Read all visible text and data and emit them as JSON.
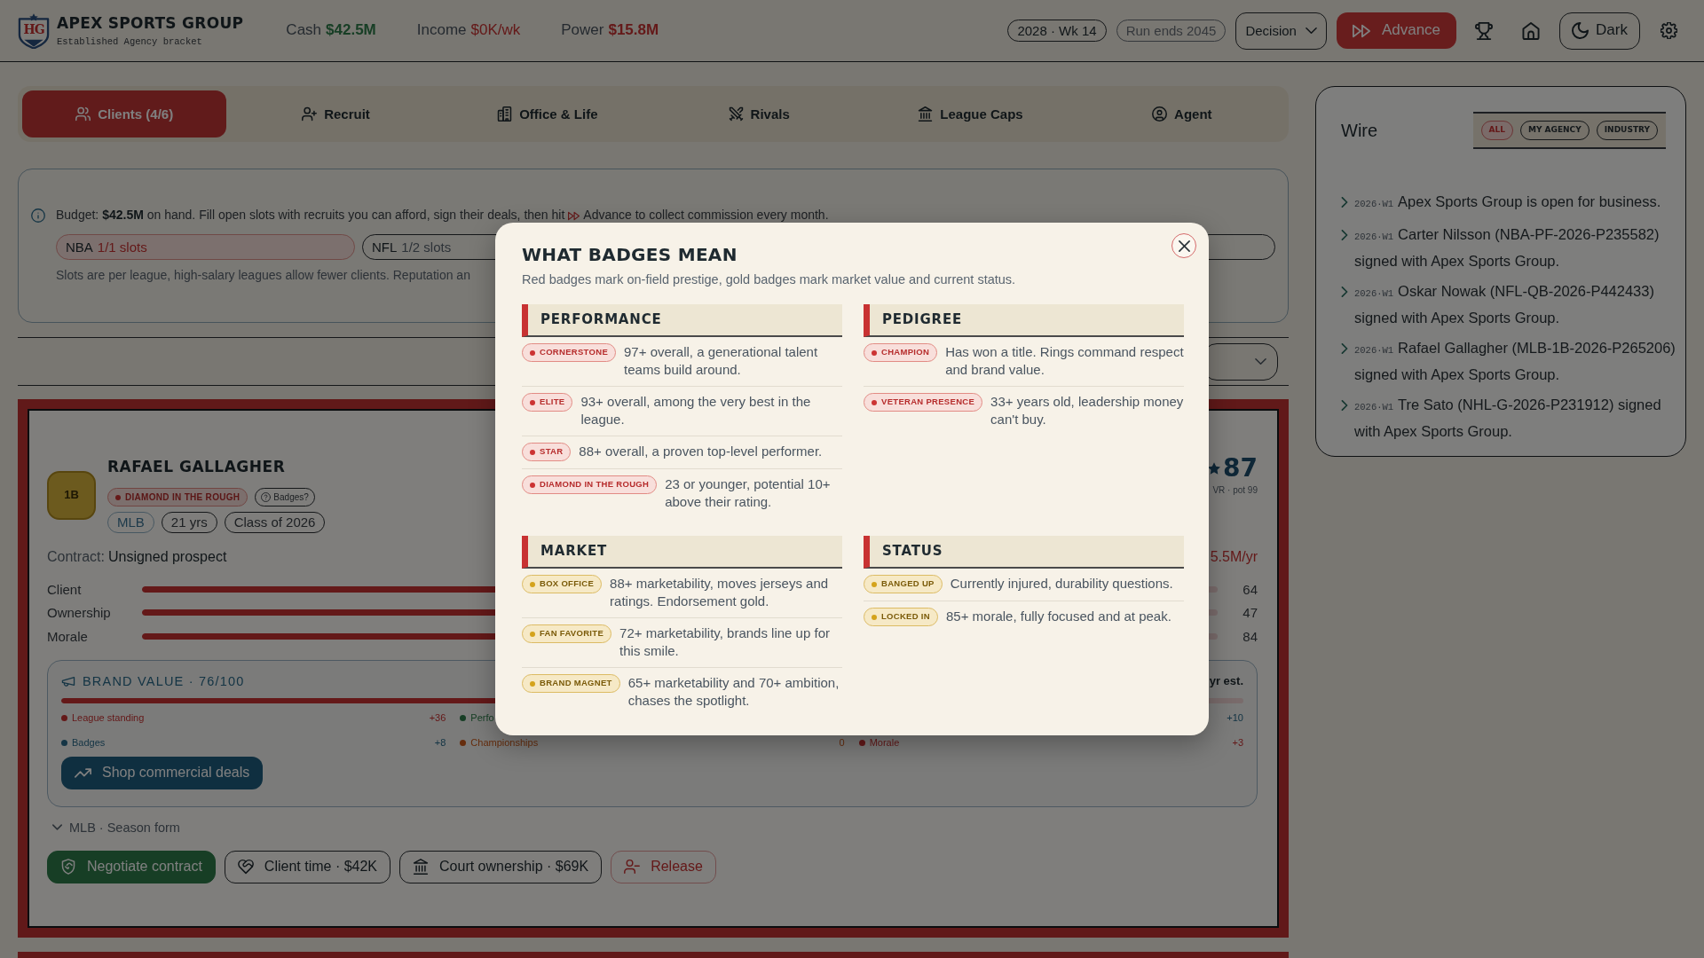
{
  "header": {
    "logo_text": "HG",
    "title": "APEX SPORTS GROUP",
    "subtitle": "Established Agency bracket",
    "stats": [
      {
        "label": "Cash",
        "value": "$42.5M",
        "kind": "positive"
      },
      {
        "label": "Income",
        "value": "$0K/wk",
        "kind": "zero"
      },
      {
        "label": "Power",
        "value": "$15.8M",
        "kind": "negative"
      }
    ],
    "week": "2028 · Wk 14",
    "run_end": "Run ends 2045",
    "decision": "Decision",
    "advance": "Advance",
    "theme": "Dark"
  },
  "tabs": [
    {
      "label": "Clients (4/6)",
      "selected": true
    },
    {
      "label": "Recruit",
      "selected": false
    },
    {
      "label": "Office & Life",
      "selected": false
    },
    {
      "label": "Rivals",
      "selected": false
    },
    {
      "label": "League Caps",
      "selected": false
    },
    {
      "label": "Agent",
      "selected": false
    }
  ],
  "info": {
    "lead": "Budget: **$42.5M** on hand. Fill open slots with recruits you can afford, sign their deals, then hit",
    "tail": "Advance to collect commission every month.",
    "slots": [
      {
        "league": "NBA",
        "count": "1/1 slots",
        "full": true
      },
      {
        "league": "NFL",
        "count": "1/2 slots",
        "full": false
      },
      {
        "full": false
      }
    ],
    "note": "Slots are per league, high-salary leagues allow fewer clients. Reputation an"
  },
  "client": {
    "position": "1B",
    "name": "RAFAEL GALLAGHER",
    "badges": [
      {
        "label": "DIAMOND IN THE ROUGH",
        "kind": "prestige"
      }
    ],
    "help": "Badges?",
    "tags": [
      {
        "label": "MLB",
        "kind": "league"
      },
      {
        "label": "21 yrs",
        "kind": "plain"
      },
      {
        "label": "Class of 2026",
        "kind": "plain"
      }
    ],
    "rating": "87",
    "rating_note": "VR · pot 99",
    "contract_label": "Contract:",
    "contract_value": "Unsigned prospect",
    "salary": "5.5M/yr",
    "stats": [
      {
        "label": "Client",
        "level": 0.64,
        "value": "64"
      },
      {
        "label": "Ownership",
        "level": 0.47,
        "value": "47"
      },
      {
        "label": "Morale",
        "level": 0.84,
        "value": "84"
      }
    ],
    "brand": {
      "title": "BRAND VALUE · 76/100",
      "estimate": "yr est.",
      "level": 0.76,
      "factors": [
        {
          "label": "League standing",
          "value": "+36",
          "kind": "red"
        },
        {
          "label": "Perfo",
          "kind": "green"
        },
        {
          "value": "+10",
          "kind": "blue"
        },
        {
          "label": "Badges",
          "value": "+8",
          "kind": "blue"
        },
        {
          "label": "Championships",
          "value": "0",
          "kind": "orange"
        },
        {
          "label": "Morale",
          "value": "+3",
          "kind": "red"
        }
      ],
      "shop": "Shop commercial deals"
    },
    "season": "MLB · Season form",
    "actions": [
      {
        "label": "Negotiate contract",
        "kind": "primary"
      },
      {
        "label": "Client time · $42K",
        "kind": "outline"
      },
      {
        "label": "Court ownership · $69K",
        "kind": "outline"
      },
      {
        "label": "Release",
        "kind": "danger"
      }
    ]
  },
  "wire": {
    "title": "Wire",
    "filters": [
      {
        "label": "ALL",
        "selected": true
      },
      {
        "label": "MY AGENCY",
        "selected": false
      },
      {
        "label": "INDUSTRY",
        "selected": false
      }
    ],
    "items": [
      {
        "stamp": "2026·W1",
        "text": "Apex Sports Group is open for business."
      },
      {
        "stamp": "2026·W1",
        "text": "Carter Nilsson (NBA-PF-2026-P235582) signed with Apex Sports Group."
      },
      {
        "stamp": "2026·W1",
        "text": "Oskar Nowak (NFL-QB-2026-P442433) signed with Apex Sports Group."
      },
      {
        "stamp": "2026·W1",
        "text": "Rafael Gallagher (MLB-1B-2026-P265206) signed with Apex Sports Group."
      },
      {
        "stamp": "2026·W1",
        "text": "Tre Sato (NHL-G-2026-P231912) signed with Apex Sports Group."
      }
    ]
  },
  "modal": {
    "title": "WHAT BADGES MEAN",
    "subtitle": "Red badges mark on-field prestige, gold badges mark market value and current status.",
    "sections": [
      {
        "title": "PERFORMANCE",
        "items": [
          {
            "badge": "CORNERSTONE",
            "kind": "prestige",
            "text": "97+ overall, a generational talent teams build around."
          },
          {
            "badge": "ELITE",
            "kind": "prestige",
            "text": "93+ overall, among the very best in the league."
          },
          {
            "badge": "STAR",
            "kind": "prestige",
            "text": "88+ overall, a proven top-level performer."
          },
          {
            "badge": "DIAMOND IN THE ROUGH",
            "kind": "prestige",
            "text": "23 or younger, potential 10+ above their rating."
          }
        ]
      },
      {
        "title": "PEDIGREE",
        "items": [
          {
            "badge": "CHAMPION",
            "kind": "prestige",
            "text": "Has won a title. Rings command respect and brand value."
          },
          {
            "badge": "VETERAN PRESENCE",
            "kind": "prestige",
            "text": "33+ years old, leadership money can't buy."
          }
        ]
      },
      {
        "title": "MARKET",
        "items": [
          {
            "badge": "BOX OFFICE",
            "kind": "market",
            "text": "88+ marketability, moves jerseys and ratings. Endorsement gold."
          },
          {
            "badge": "FAN FAVORITE",
            "kind": "market",
            "text": "72+ marketability, brands line up for this smile."
          },
          {
            "badge": "BRAND MAGNET",
            "kind": "market",
            "text": "65+ marketability and 70+ ambition, chases the spotlight."
          }
        ]
      },
      {
        "title": "STATUS",
        "items": [
          {
            "badge": "BANGED UP",
            "kind": "market",
            "text": "Currently injured, durability questions."
          },
          {
            "badge": "LOCKED IN",
            "kind": "market",
            "text": "85+ morale, fully focused and at peak."
          }
        ]
      }
    ]
  }
}
